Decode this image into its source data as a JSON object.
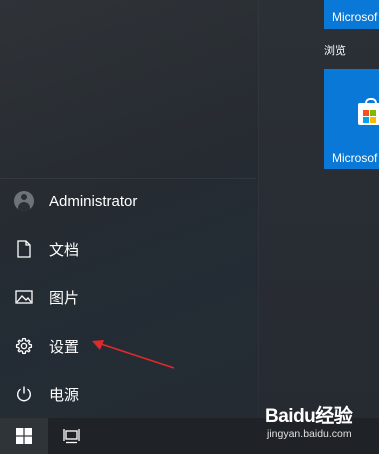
{
  "user": {
    "name": "Administrator"
  },
  "menu_items": [
    {
      "label": "文档",
      "icon": "document-icon"
    },
    {
      "label": "图片",
      "icon": "pictures-icon"
    },
    {
      "label": "设置",
      "icon": "settings-gear-icon"
    },
    {
      "label": "电源",
      "icon": "power-icon"
    }
  ],
  "tiles": {
    "top_tile_label": "Microsof",
    "section_label": "浏览",
    "store_tile_label": "Microsof"
  },
  "taskbar": {
    "start_icon": "windows-logo-icon",
    "task_view_icon": "task-view-icon"
  },
  "watermark": {
    "logo": "Baidu经验",
    "url": "jingyan.baidu.com"
  },
  "colors": {
    "tile_blue": "#0a78d7",
    "annotation_red": "#e02a2a"
  }
}
